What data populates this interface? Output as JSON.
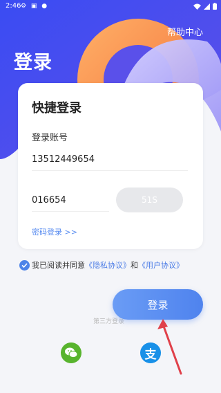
{
  "status_bar": {
    "time": "2:46",
    "notification_icons": "⚙ ▣ ●"
  },
  "header": {
    "help_link": "帮助中心",
    "page_title": "登录"
  },
  "card": {
    "title": "快捷登录",
    "account_label": "登录账号",
    "phone_value": "13512449654",
    "code_value": "016654",
    "countdown_label": "51S",
    "password_login_link": "密码登录 >>"
  },
  "agreement": {
    "prefix": "我已阅读并同意",
    "privacy_link": "《隐私协议》",
    "conjunction": "和",
    "user_link": "《用户协议》",
    "checked": true
  },
  "other_login_hint": "第三方登录",
  "login_button": "登录",
  "third_party": {
    "wechat_icon": "wechat-icon",
    "alipay_icon": "alipay-icon",
    "alipay_glyph": "支"
  },
  "colors": {
    "accent": "#4f83ee",
    "hero_blue": "#4a55f0",
    "wechat": "#58b42e",
    "alipay": "#1890e8",
    "annotation_arrow": "#e0404a"
  }
}
